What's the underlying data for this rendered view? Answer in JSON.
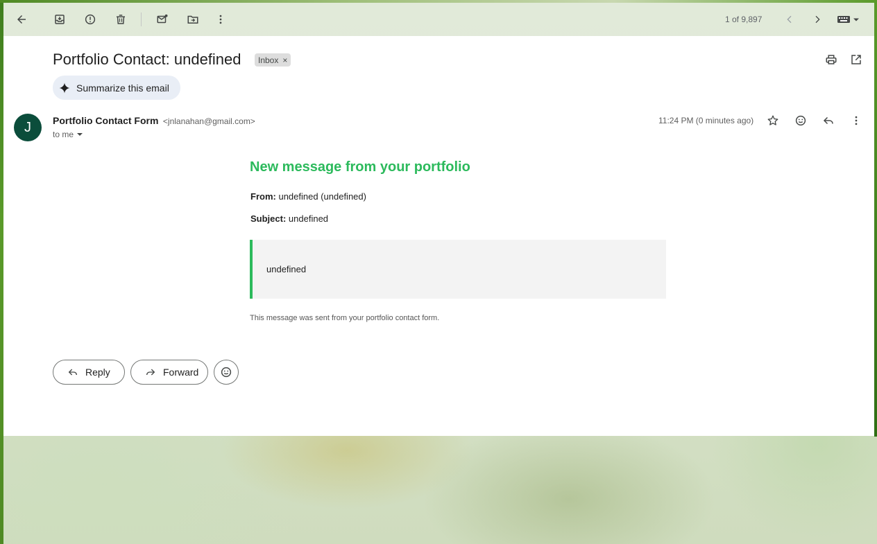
{
  "toolbar": {
    "back_icon": "arrow-left-icon",
    "archive_icon": "archive-icon",
    "spam_icon": "report-spam-icon",
    "delete_icon": "trash-icon",
    "mark_unread_icon": "mark-unread-icon",
    "move_icon": "move-to-folder-icon",
    "more_icon": "more-vert-icon",
    "counter": "1 of 9,897",
    "newer_icon": "chevron-left-icon",
    "older_icon": "chevron-right-icon",
    "input_tools_icon": "keyboard-icon"
  },
  "email": {
    "subject": "Portfolio Contact: undefined",
    "label": "Inbox",
    "label_remove": "×",
    "summarize_label": "Summarize this email",
    "sender_initial": "J",
    "sender_name": "Portfolio Contact Form",
    "sender_email": "<jnlanahan@gmail.com>",
    "recipient": "to me",
    "timestamp": "11:24 PM (0 minutes ago)"
  },
  "message": {
    "heading": "New message from your portfolio",
    "from_label": "From:",
    "from_value": "undefined (undefined)",
    "subject_label": "Subject:",
    "subject_value": "undefined",
    "body": "undefined",
    "footnote": "This message was sent from your portfolio contact form."
  },
  "actions": {
    "reply_label": "Reply",
    "forward_label": "Forward"
  },
  "colors": {
    "accent_green": "#2cba5c",
    "avatar_bg": "#0b4d3b"
  }
}
